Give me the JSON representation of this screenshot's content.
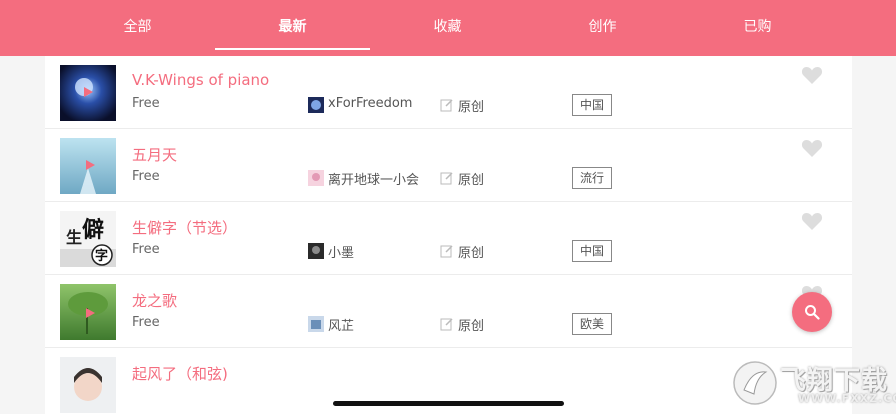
{
  "tabs": [
    "全部",
    "最新",
    "收藏",
    "创作",
    "已购"
  ],
  "active_tab": "最新",
  "songs": [
    {
      "title": "V.K-Wings of piano",
      "price": "Free",
      "author": "xForFreedom",
      "original": "原创",
      "tags": [
        "中国"
      ]
    },
    {
      "title": "五月天",
      "price": "Free",
      "author": "离开地球一小会",
      "original": "原创",
      "tags": [
        "流行"
      ]
    },
    {
      "title": "生僻字（节选）",
      "price": "Free",
      "author": "小墨",
      "original": "原创",
      "tags": [
        "中国"
      ]
    },
    {
      "title": "龙之歌",
      "price": "Free",
      "author": "风芷",
      "original": "原创",
      "tags": [
        "欧美"
      ]
    },
    {
      "title": "起风了（和弦)",
      "price": "",
      "author": "",
      "original": "",
      "tags": []
    }
  ],
  "watermark": {
    "text": "飞翔下载",
    "url": "WWW.FXXZ.COM"
  },
  "colors": {
    "accent": "#f46d7f",
    "heart": "#dddddd"
  },
  "icons": {
    "heart": "heart-icon",
    "fab": "search-icon",
    "original": "edit-icon"
  }
}
